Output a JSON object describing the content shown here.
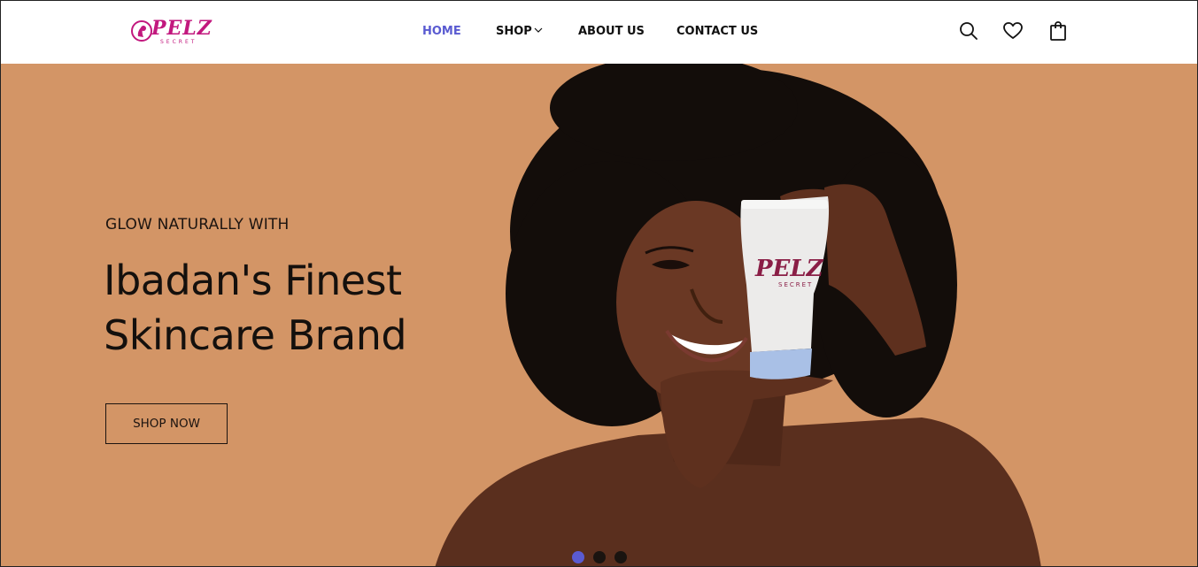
{
  "brand": {
    "logo_text": "PELZ",
    "logo_subtext": "SECRET",
    "color": "#c2187e"
  },
  "nav": {
    "items": [
      {
        "label": "HOME",
        "active": true
      },
      {
        "label": "SHOP",
        "has_dropdown": true
      },
      {
        "label": "ABOUT US"
      },
      {
        "label": "CONTACT US"
      }
    ],
    "active_color": "#5a5bd1"
  },
  "header_icons": [
    "search-icon",
    "heart-icon",
    "shopping-bag-icon"
  ],
  "hero": {
    "eyebrow": "GLOW NATURALLY WITH",
    "headline": "Ibadan's Finest Skincare Brand",
    "cta_label": "SHOP NOW",
    "background_color": "#d39566",
    "product_logo_text": "PELZ",
    "product_logo_subtext": "SECRET"
  },
  "carousel": {
    "slide_count": 3,
    "active_index": 0
  }
}
